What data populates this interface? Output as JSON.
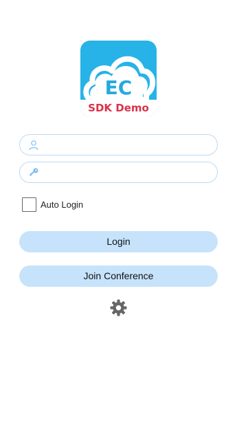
{
  "logo": {
    "title": "EC",
    "subtitle": "SDK Demo",
    "bg_color": "#27b3e8",
    "subtitle_color": "#d8334a"
  },
  "form": {
    "username": {
      "icon": "user-icon",
      "value": "",
      "placeholder": ""
    },
    "password": {
      "icon": "key-icon",
      "value": "",
      "placeholder": ""
    },
    "auto_login": {
      "label": "Auto Login",
      "checked": false
    },
    "login_label": "Login",
    "join_conference_label": "Join Conference"
  },
  "settings": {
    "icon": "gear-icon"
  },
  "colors": {
    "accent_light": "#c6e3fb",
    "field_border": "#b9daf3",
    "icon_blue": "#7fbef0",
    "gear": "#666666"
  }
}
